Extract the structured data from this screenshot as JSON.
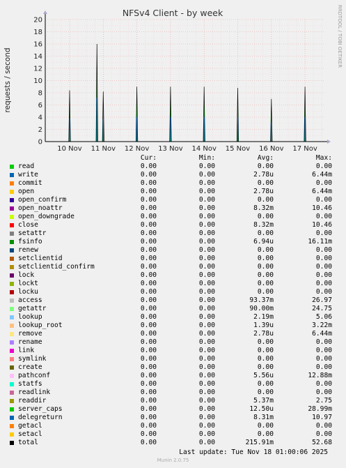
{
  "chart_data": {
    "type": "area",
    "title": "NFSv4 Client - by week",
    "ylabel": "requests / second",
    "ylim": [
      0,
      20
    ],
    "yticks": [
      "0",
      "2",
      "4",
      "6",
      "8",
      "10",
      "12",
      "14",
      "16",
      "18",
      "20"
    ],
    "xticks": [
      "10 Nov",
      "11 Nov",
      "12 Nov",
      "13 Nov",
      "14 Nov",
      "15 Nov",
      "16 Nov",
      "17 Nov"
    ],
    "grid": true,
    "spikes": [
      {
        "x": "10 Nov 00:00",
        "y": 8.4
      },
      {
        "x": "10 Nov 19:30",
        "y": 16.0
      },
      {
        "x": "11 Nov 00:00",
        "y": 8.2
      },
      {
        "x": "12 Nov 00:00",
        "y": 9.0
      },
      {
        "x": "13 Nov 00:00",
        "y": 9.0
      },
      {
        "x": "14 Nov 00:00",
        "y": 9.0
      },
      {
        "x": "15 Nov 00:00",
        "y": 8.8
      },
      {
        "x": "16 Nov 00:00",
        "y": 7.0
      },
      {
        "x": "17 Nov 00:00",
        "y": 9.0
      }
    ],
    "legend_header": {
      "cur": "Cur:",
      "min": "Min:",
      "avg": "Avg:",
      "max": "Max:"
    },
    "series": [
      {
        "name": "read",
        "color": "#00cc00",
        "cur": "0.00",
        "min": "0.00",
        "avg": "0.00",
        "max": "0.00"
      },
      {
        "name": "write",
        "color": "#0066b3",
        "cur": "0.00",
        "min": "0.00",
        "avg": "2.78u",
        "max": "6.44m"
      },
      {
        "name": "commit",
        "color": "#ff8000",
        "cur": "0.00",
        "min": "0.00",
        "avg": "0.00",
        "max": "0.00"
      },
      {
        "name": "open",
        "color": "#ffcc00",
        "cur": "0.00",
        "min": "0.00",
        "avg": "2.78u",
        "max": "6.44m"
      },
      {
        "name": "open_confirm",
        "color": "#330099",
        "cur": "0.00",
        "min": "0.00",
        "avg": "0.00",
        "max": "0.00"
      },
      {
        "name": "open_noattr",
        "color": "#990099",
        "cur": "0.00",
        "min": "0.00",
        "avg": "8.32m",
        "max": "10.46"
      },
      {
        "name": "open_downgrade",
        "color": "#ccff00",
        "cur": "0.00",
        "min": "0.00",
        "avg": "0.00",
        "max": "0.00"
      },
      {
        "name": "close",
        "color": "#ff0000",
        "cur": "0.00",
        "min": "0.00",
        "avg": "8.32m",
        "max": "10.46"
      },
      {
        "name": "setattr",
        "color": "#808080",
        "cur": "0.00",
        "min": "0.00",
        "avg": "0.00",
        "max": "0.00"
      },
      {
        "name": "fsinfo",
        "color": "#008f00",
        "cur": "0.00",
        "min": "0.00",
        "avg": "6.94u",
        "max": "16.11m"
      },
      {
        "name": "renew",
        "color": "#00487d",
        "cur": "0.00",
        "min": "0.00",
        "avg": "0.00",
        "max": "0.00"
      },
      {
        "name": "setclientid",
        "color": "#b35a00",
        "cur": "0.00",
        "min": "0.00",
        "avg": "0.00",
        "max": "0.00"
      },
      {
        "name": "setclientid_confirm",
        "color": "#b38f00",
        "cur": "0.00",
        "min": "0.00",
        "avg": "0.00",
        "max": "0.00"
      },
      {
        "name": "lock",
        "color": "#6b006b",
        "cur": "0.00",
        "min": "0.00",
        "avg": "0.00",
        "max": "0.00"
      },
      {
        "name": "lockt",
        "color": "#8fb300",
        "cur": "0.00",
        "min": "0.00",
        "avg": "0.00",
        "max": "0.00"
      },
      {
        "name": "locku",
        "color": "#b30000",
        "cur": "0.00",
        "min": "0.00",
        "avg": "0.00",
        "max": "0.00"
      },
      {
        "name": "access",
        "color": "#bebebe",
        "cur": "0.00",
        "min": "0.00",
        "avg": "93.37m",
        "max": "26.97"
      },
      {
        "name": "getattr",
        "color": "#80ff80",
        "cur": "0.00",
        "min": "0.00",
        "avg": "90.00m",
        "max": "24.75"
      },
      {
        "name": "lookup",
        "color": "#80c9ff",
        "cur": "0.00",
        "min": "0.00",
        "avg": "2.19m",
        "max": "5.06"
      },
      {
        "name": "lookup_root",
        "color": "#ffc080",
        "cur": "0.00",
        "min": "0.00",
        "avg": "1.39u",
        "max": "3.22m"
      },
      {
        "name": "remove",
        "color": "#ffe680",
        "cur": "0.00",
        "min": "0.00",
        "avg": "2.78u",
        "max": "6.44m"
      },
      {
        "name": "rename",
        "color": "#aa80ff",
        "cur": "0.00",
        "min": "0.00",
        "avg": "0.00",
        "max": "0.00"
      },
      {
        "name": "link",
        "color": "#ee00cc",
        "cur": "0.00",
        "min": "0.00",
        "avg": "0.00",
        "max": "0.00"
      },
      {
        "name": "symlink",
        "color": "#ff8080",
        "cur": "0.00",
        "min": "0.00",
        "avg": "0.00",
        "max": "0.00"
      },
      {
        "name": "create",
        "color": "#666600",
        "cur": "0.00",
        "min": "0.00",
        "avg": "0.00",
        "max": "0.00"
      },
      {
        "name": "pathconf",
        "color": "#ffbfff",
        "cur": "0.00",
        "min": "0.00",
        "avg": "5.56u",
        "max": "12.88m"
      },
      {
        "name": "statfs",
        "color": "#00ffcc",
        "cur": "0.00",
        "min": "0.00",
        "avg": "0.00",
        "max": "0.00"
      },
      {
        "name": "readlink",
        "color": "#cc6699",
        "cur": "0.00",
        "min": "0.00",
        "avg": "0.00",
        "max": "0.00"
      },
      {
        "name": "readdir",
        "color": "#999900",
        "cur": "0.00",
        "min": "0.00",
        "avg": "5.37m",
        "max": "2.75"
      },
      {
        "name": "server_caps",
        "color": "#00cc00",
        "cur": "0.00",
        "min": "0.00",
        "avg": "12.50u",
        "max": "28.99m"
      },
      {
        "name": "delegreturn",
        "color": "#0066b3",
        "cur": "0.00",
        "min": "0.00",
        "avg": "8.31m",
        "max": "10.97"
      },
      {
        "name": "getacl",
        "color": "#ff8000",
        "cur": "0.00",
        "min": "0.00",
        "avg": "0.00",
        "max": "0.00"
      },
      {
        "name": "setacl",
        "color": "#ffcc00",
        "cur": "0.00",
        "min": "0.00",
        "avg": "0.00",
        "max": "0.00"
      },
      {
        "name": "total",
        "color": "#000000",
        "cur": "0.00",
        "min": "0.00",
        "avg": "215.91m",
        "max": "52.68"
      }
    ]
  },
  "footer": {
    "last_update": "Last update: Tue Nov 18 01:00:06 2025",
    "munin": "Munin 2.0.75",
    "watermark": "RRDTOOL / TOBI OETIKER"
  }
}
